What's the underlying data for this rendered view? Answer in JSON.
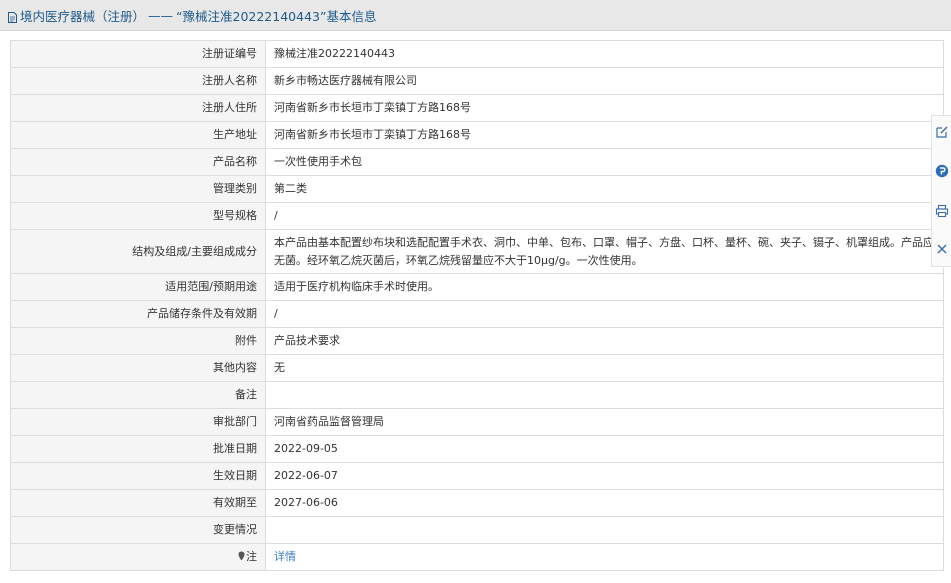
{
  "header": {
    "category": "境内医疗器械（注册）",
    "separator": "——",
    "record_title": "“豫械注准20222140443”基本信息"
  },
  "rows": [
    {
      "label": "注册证编号",
      "value": "豫械注准20222140443"
    },
    {
      "label": "注册人名称",
      "value": "新乡市畅达医疗器械有限公司"
    },
    {
      "label": "注册人住所",
      "value": "河南省新乡市长垣市丁栾镇丁方路168号"
    },
    {
      "label": "生产地址",
      "value": "河南省新乡市长垣市丁栾镇丁方路168号"
    },
    {
      "label": "产品名称",
      "value": "一次性使用手术包"
    },
    {
      "label": "管理类别",
      "value": "第二类"
    },
    {
      "label": "型号规格",
      "value": "/"
    },
    {
      "label": "结构及组成/主要组成成分",
      "value": "本产品由基本配置纱布块和选配配置手术衣、洞巾、中单、包布、口罩、帽子、方盘、口杯、量杯、碗、夹子、镊子、机罩组成。产品应无菌。经环氧乙烷灭菌后，环氧乙烷残留量应不大于10μg/g。一次性使用。"
    },
    {
      "label": "适用范围/预期用途",
      "value": "适用于医疗机构临床手术时使用。"
    },
    {
      "label": "产品储存条件及有效期",
      "value": "/"
    },
    {
      "label": "附件",
      "value": "产品技术要求"
    },
    {
      "label": "其他内容",
      "value": "无"
    },
    {
      "label": "备注",
      "value": ""
    },
    {
      "label": "审批部门",
      "value": "河南省药品监督管理局"
    },
    {
      "label": "批准日期",
      "value": "2022-09-05"
    },
    {
      "label": "生效日期",
      "value": "2022-06-07"
    },
    {
      "label": "有效期至",
      "value": "2027-06-06"
    },
    {
      "label": "变更情况",
      "value": ""
    },
    {
      "label": "注",
      "value": "详情"
    }
  ],
  "sidebar_tools": [
    {
      "name": "edit-icon"
    },
    {
      "name": "help-icon"
    },
    {
      "name": "print-icon"
    },
    {
      "name": "close-icon"
    }
  ],
  "colors": {
    "title_text": "#1f5a8c",
    "label_bg": "#f5f5f5",
    "border": "#dcdcdc",
    "link": "#3a7fbf"
  }
}
